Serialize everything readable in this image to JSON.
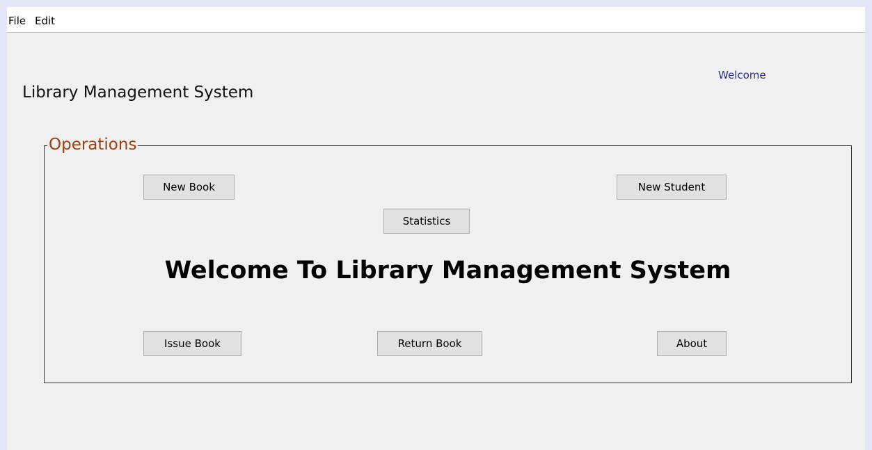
{
  "menubar": {
    "items": [
      {
        "label": "File"
      },
      {
        "label": "Edit"
      }
    ]
  },
  "header": {
    "app_title": "Library Management System",
    "welcome_user": "Welcome"
  },
  "operations": {
    "legend": "Operations",
    "buttons": {
      "new_book": "New Book",
      "new_student": "New Student",
      "statistics": "Statistics",
      "issue_book": "Issue Book",
      "return_book": "Return Book",
      "about": "About"
    },
    "banner": "Welcome To Library Management System"
  },
  "colors": {
    "legend_text": "#9c3e12",
    "welcome_text": "#2b2b86",
    "window_bg": "#f0f0f0",
    "button_bg": "#e1e1e1"
  }
}
